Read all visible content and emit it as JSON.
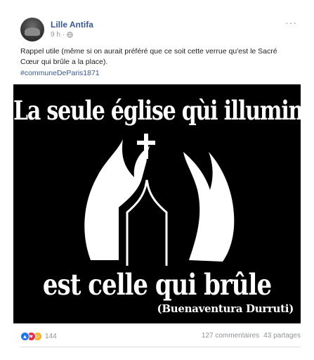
{
  "post": {
    "author": "Lille Antifa",
    "time": "9 h",
    "more_label": "···",
    "text": "Rappel utile (même si on aurait préféré que ce soit cette verrue qu'est le Sacré Cœur qui brûle a la place).",
    "hashtag": "#communeDeParis1871"
  },
  "image": {
    "headline_top": "La seule église qùi illumine",
    "headline_bottom": "est celle qui brûle",
    "quote_author": "(Buenaventura Durruti)"
  },
  "footer": {
    "reaction_count": "144",
    "comments": "127 commentaires",
    "shares": "43 partages"
  },
  "icons": {
    "reactions": [
      "like-icon",
      "love-icon",
      "haha-icon"
    ],
    "globe": "globe-icon"
  },
  "colors": {
    "link": "#385898",
    "muted": "#90949c",
    "like": "#1877f2",
    "love": "#f0284a",
    "haha": "#f7b125"
  }
}
